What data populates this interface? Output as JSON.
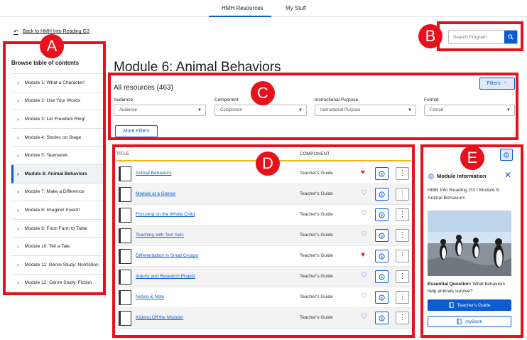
{
  "topnav": {
    "tabs": [
      {
        "label": "HMH Resources"
      },
      {
        "label": "My Stuff"
      }
    ]
  },
  "back_link": "Back to HMH Into Reading G3",
  "search": {
    "placeholder": "Search Program"
  },
  "page_title": "Module 6: Animal Behaviors",
  "annotations": {
    "a": "A",
    "b": "B",
    "c": "C",
    "d": "D",
    "e": "E",
    "color": "#e8101b"
  },
  "sidebar": {
    "title": "Browse table of contents",
    "items": [
      {
        "label": "Module 1: What a Character!"
      },
      {
        "label": "Module 2: Use Your Words"
      },
      {
        "label": "Module 3: Let Freedom Ring!"
      },
      {
        "label": "Module 4: Stories on Stage"
      },
      {
        "label": "Module 5: Teamwork"
      },
      {
        "label": "Module 6: Animal Behaviors",
        "active": true
      },
      {
        "label": "Module 7: Make a Difference"
      },
      {
        "label": "Module 8: Imagine! Invent!"
      },
      {
        "label": "Module 9: From Farm to Table"
      },
      {
        "label": "Module 10: Tell a Tale"
      },
      {
        "label": "Module 11: Genre Study: Nonfiction"
      },
      {
        "label": "Module 12: Genre Study: Fiction"
      }
    ]
  },
  "filters": {
    "title": "All resources (463)",
    "toggle_label": "Filters",
    "more_label": "More Filters",
    "fields": [
      {
        "label": "Audience",
        "value": "Audience"
      },
      {
        "label": "Component",
        "value": "Component"
      },
      {
        "label": "Instructional Purpose",
        "value": "Instructional Purpose"
      },
      {
        "label": "Format",
        "value": "Format"
      }
    ]
  },
  "table": {
    "headers": {
      "title": "TITLE",
      "component": "COMPONENT"
    },
    "rows": [
      {
        "title": "Animal Behaviors",
        "component": "Teacher's Guide",
        "favorite": true
      },
      {
        "title": "Module at a Glance",
        "component": "Teacher's Guide",
        "favorite": false
      },
      {
        "title": "Focusing on the Whole Child",
        "component": "Teacher's Guide",
        "favorite": false
      },
      {
        "title": "Teaching with Text Sets",
        "component": "Teacher's Guide",
        "favorite": false
      },
      {
        "title": "Differentiation in Small Groups",
        "component": "Teacher's Guide",
        "favorite": true
      },
      {
        "title": "Inquiry and Research Project",
        "component": "Teacher's Guide",
        "favorite": false
      },
      {
        "title": "Notice & Note",
        "component": "Teacher's Guide",
        "favorite": false
      },
      {
        "title": "Kicking Off the Module!",
        "component": "Teacher's Guide",
        "favorite": false
      }
    ]
  },
  "panel": {
    "title": "Module Information",
    "path_program": "HMH Into Reading G3",
    "path_separator": "/",
    "path_module": "Module 6: Animal Behaviors",
    "eq_label": "Essential Question:",
    "eq_text": "What behaviors help animals survive?",
    "primary_button": "Teacher's Guide",
    "secondary_button": "myBook"
  },
  "colors": {
    "accent": "#0b5bd3",
    "favorite": "#e0212e",
    "header_rule": "#f2b71f"
  }
}
